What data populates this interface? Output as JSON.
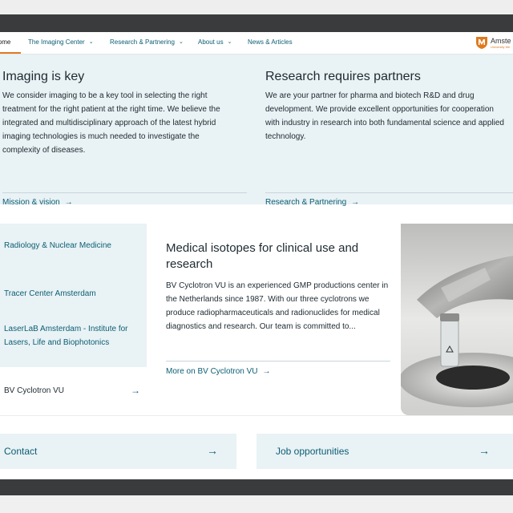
{
  "nav": {
    "home": "Home",
    "items": [
      "The Imaging Center",
      "Research & Partnering",
      "About us",
      "News & Articles"
    ],
    "logo_text": "Amste",
    "logo_sub": "University Me"
  },
  "hero": {
    "left": {
      "title": "Imaging is key",
      "text": "We consider imaging to be a key tool in selecting the right treatment for the right patient at the right time. We believe the integrated and multidisciplinary approach of the latest hybrid imaging technologies is much needed to investigate the complexity of diseases.",
      "link": "Mission & vision"
    },
    "right": {
      "title": "Research requires partners",
      "text": "We are your partner for pharma and biotech R&D and drug development. We provide excellent opportunities for cooperation with industry in research into both fundamental science and applied technology.",
      "link": "Research & Partnering"
    }
  },
  "side_nav": {
    "items": [
      "Radiology & Nuclear Medicine",
      "Tracer Center Amsterdam",
      "LaserLaB Amsterdam - Institute for Lasers, Life and Biophotonics"
    ],
    "active": "BV Cyclotron VU"
  },
  "feature": {
    "title": "Medical isotopes for clinical use and research",
    "text": "BV Cyclotron VU is an experienced GMP productions center in the Netherlands since 1987. With our three cyclotrons we produce radiopharmaceuticals and radionuclides for medical diagnostics and research. Our team is committed to...",
    "link": "More on BV Cyclotron VU"
  },
  "bottom": {
    "contact": "Contact",
    "jobs": "Job opportunities"
  },
  "icons": {
    "arrow": "arrow-right-icon",
    "chevron": "chevron-down-icon"
  },
  "colors": {
    "accent": "#0b5e73",
    "nav_underline": "#e07a1f",
    "panel_bg": "#e9f2f5"
  }
}
